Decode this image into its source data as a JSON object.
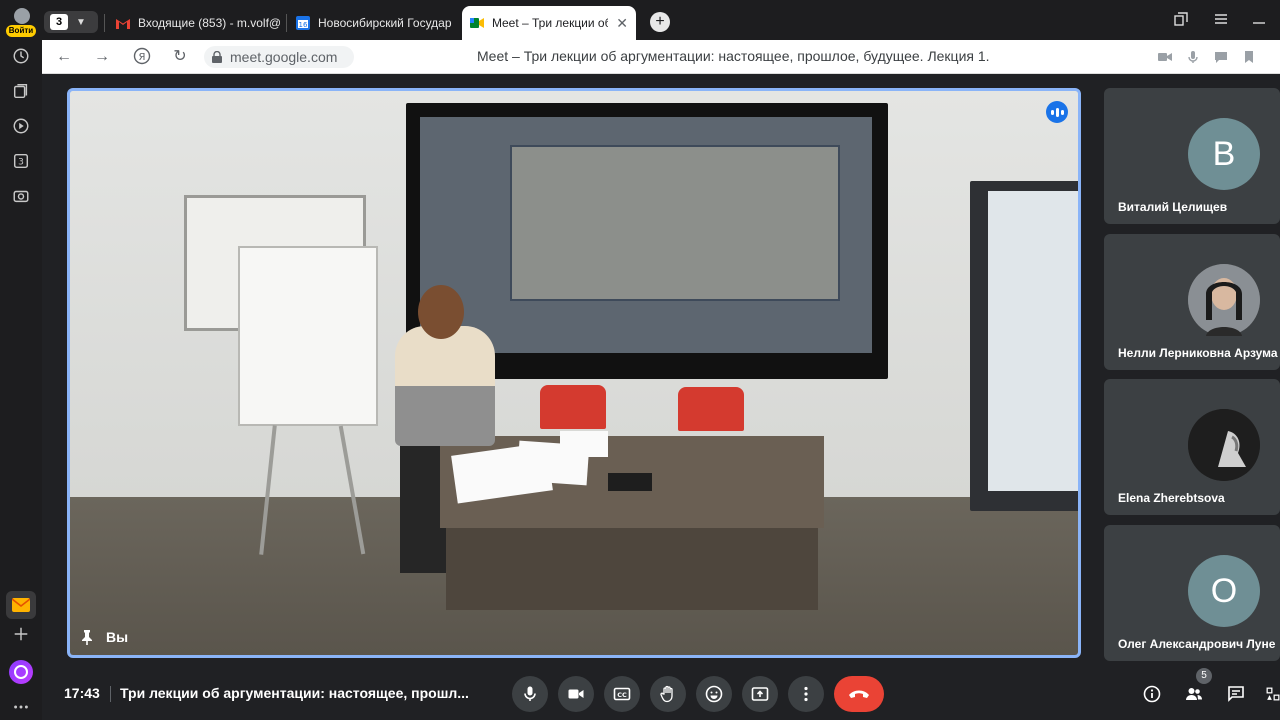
{
  "yandex_rail": {
    "login_label": "Войти",
    "items": [
      "history-icon",
      "collections-icon",
      "video-icon",
      "tabs-3-icon",
      "screenshot-icon"
    ],
    "counter": "3"
  },
  "tabbar": {
    "tabs_count": "3",
    "tabs": [
      {
        "title": "Входящие (853) - m.volf@",
        "favicon": "gmail-icon",
        "active": false
      },
      {
        "title": "Новосибирский Государс",
        "favicon": "calendar-16-icon",
        "fav_text": "16",
        "active": false
      },
      {
        "title": "Meet – Три лекции об а",
        "favicon": "meet-icon",
        "active": true
      }
    ],
    "new_tab": "+"
  },
  "addressbar": {
    "host": "meet.google.com",
    "title": "Meet – Три лекции об аргументации: настоящее, прошлое, будущее. Лекция 1."
  },
  "meet": {
    "main_tile_label": "Вы",
    "participants": [
      {
        "name": "Виталий Целищев",
        "initial": "В",
        "color": "#6f8f95",
        "photo": false
      },
      {
        "name": "Нелли Лерниковна Арзума",
        "initial": "",
        "color": "#6d6d6d",
        "photo": true
      },
      {
        "name": "Elena Zherebtsova",
        "initial": "",
        "color": "#2a2a2a",
        "photo": true
      },
      {
        "name": "Олег Александрович Луне",
        "initial": "О",
        "color": "#6f8f95",
        "photo": false
      }
    ],
    "clock": "17:43",
    "meeting_name": "Три лекции об аргументации: настоящее, прошл...",
    "participant_count": "5",
    "colors": {
      "accent": "#8ab4f8",
      "end_call": "#ea4335",
      "bg": "#202124"
    }
  }
}
